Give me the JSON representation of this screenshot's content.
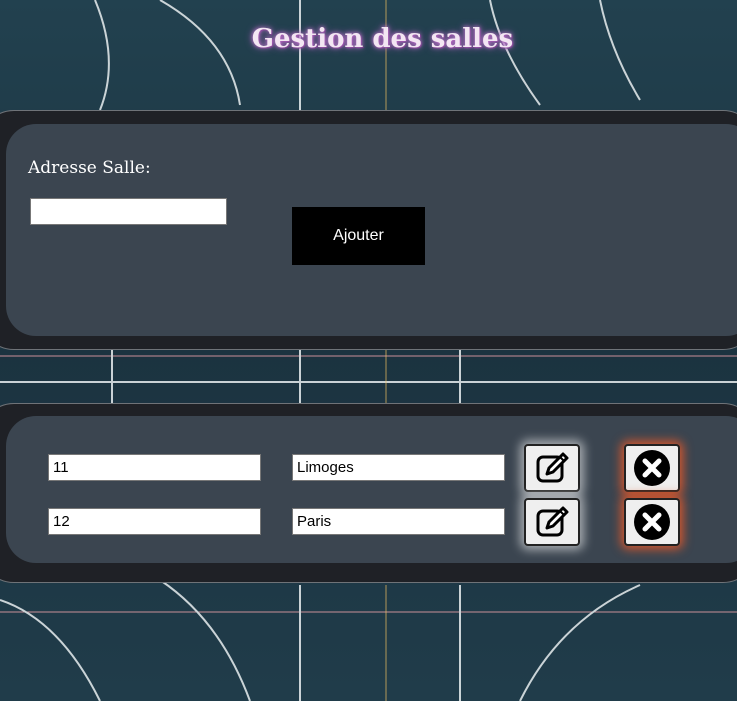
{
  "page": {
    "title": "Gestion des salles"
  },
  "form": {
    "address_label": "Adresse Salle:",
    "address_value": "",
    "add_button_label": "Ajouter"
  },
  "rooms": [
    {
      "id": "11",
      "city": "Limoges",
      "edit_icon": "edit-icon",
      "delete_icon": "delete-icon"
    },
    {
      "id": "12",
      "city": "Paris",
      "edit_icon": "edit-icon",
      "delete_icon": "delete-icon"
    }
  ],
  "colors": {
    "panel_outer": "#1f2126",
    "panel_inner": "#3b4550",
    "button": "#000000",
    "delete_glow": "#f05a28"
  }
}
